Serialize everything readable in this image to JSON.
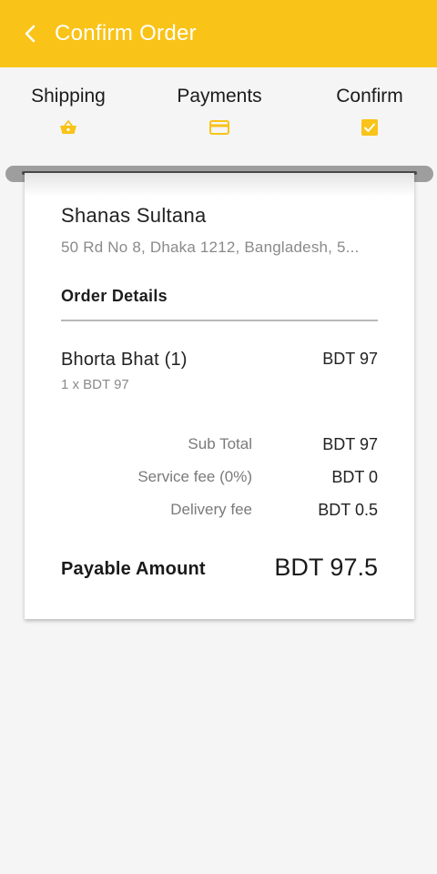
{
  "header": {
    "title": "Confirm Order",
    "back_icon": "chevron-left-icon",
    "background_color": "#f9c318"
  },
  "steps": [
    {
      "label": "Shipping",
      "icon": "basket-icon"
    },
    {
      "label": "Payments",
      "icon": "credit-card-icon"
    },
    {
      "label": "Confirm",
      "icon": "checkbox-checked-icon"
    }
  ],
  "receipt": {
    "customer_name": "Shanas Sultana",
    "address": "50 Rd No 8, Dhaka 1212, Bangladesh, 5...",
    "order_details_title": "Order Details",
    "item": {
      "name": "Bhorta Bhat (1)",
      "quantity_line": "1 x BDT 97",
      "price": "BDT 97"
    },
    "summary": [
      {
        "label": "Sub Total",
        "value": "BDT 97"
      },
      {
        "label": "Service fee (0%)",
        "value": "BDT 0"
      },
      {
        "label": "Delivery fee",
        "value": "BDT 0.5"
      }
    ],
    "payable_label": "Payable Amount",
    "payable_value": "BDT 97.5"
  },
  "colors": {
    "accent": "#f9c318",
    "background": "#f5f5f5"
  }
}
